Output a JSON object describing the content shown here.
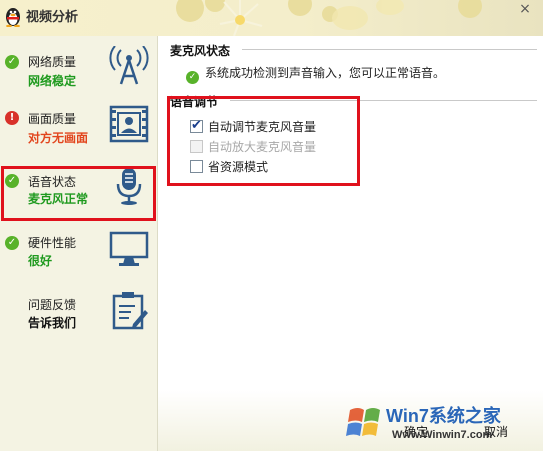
{
  "window": {
    "title": "视频分析",
    "close_symbol": "×"
  },
  "sidebar": {
    "items": [
      {
        "label": "网络质量",
        "status": "网络稳定",
        "status_type": "ok",
        "icon": "signal-tower-icon"
      },
      {
        "label": "画面质量",
        "status": "对方无画面",
        "status_type": "error",
        "icon": "video-frame-icon"
      },
      {
        "label": "语音状态",
        "status": "麦克风正常",
        "status_type": "ok",
        "icon": "microphone-icon"
      },
      {
        "label": "硬件性能",
        "status": "很好",
        "status_type": "ok",
        "icon": "monitor-icon"
      },
      {
        "label": "问题反馈",
        "status": "告诉我们",
        "status_type": "none",
        "icon": "feedback-form-icon"
      }
    ]
  },
  "main": {
    "mic_section_title": "麦克风状态",
    "mic_status_text": "系统成功检测到声音输入，您可以正常语音。",
    "voice_section_title": "语音调节",
    "options": [
      {
        "label": "自动调节麦克风音量",
        "checked": true,
        "disabled": false
      },
      {
        "label": "自动放大麦克风音量",
        "checked": false,
        "disabled": true
      },
      {
        "label": "省资源模式",
        "checked": false,
        "disabled": false
      }
    ]
  },
  "footer": {
    "ok_label": "确定",
    "cancel_label": "取消"
  },
  "watermark": {
    "brand": "Win7系统之家",
    "url": "Www.Winwin7.com"
  },
  "colors": {
    "ok_green": "#58b22a",
    "error_red": "#d8312a",
    "highlight_red": "#e0111c",
    "status_green_text": "#1f9a1f",
    "status_red_text": "#e2451d"
  }
}
